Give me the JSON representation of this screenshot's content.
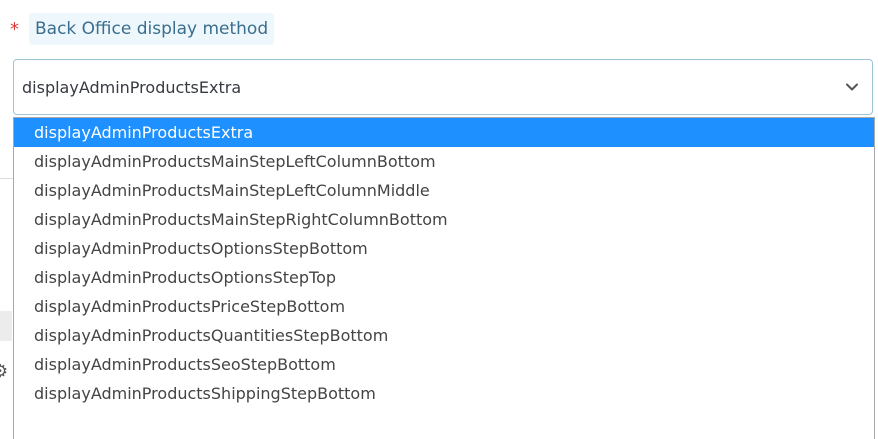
{
  "form": {
    "required_marker": "*",
    "label": "Back Office display method",
    "select": {
      "selected_value": "displayAdminProductsExtra",
      "expand_icon": "chevron-down-icon",
      "highlighted_index": 0,
      "options": [
        "displayAdminProductsExtra",
        "displayAdminProductsMainStepLeftColumnBottom",
        "displayAdminProductsMainStepLeftColumnMiddle",
        "displayAdminProductsMainStepRightColumnBottom",
        "displayAdminProductsOptionsStepBottom",
        "displayAdminProductsOptionsStepTop",
        "displayAdminProductsPriceStepBottom",
        "displayAdminProductsQuantitiesStepBottom",
        "displayAdminProductsSeoStepBottom",
        "displayAdminProductsShippingStepBottom"
      ]
    }
  },
  "colors": {
    "required": "#e0393e",
    "label_text": "#3a6e8e",
    "label_bg": "#eef7fb",
    "select_border": "#9fc4d4",
    "highlight": "#1e90ff"
  }
}
